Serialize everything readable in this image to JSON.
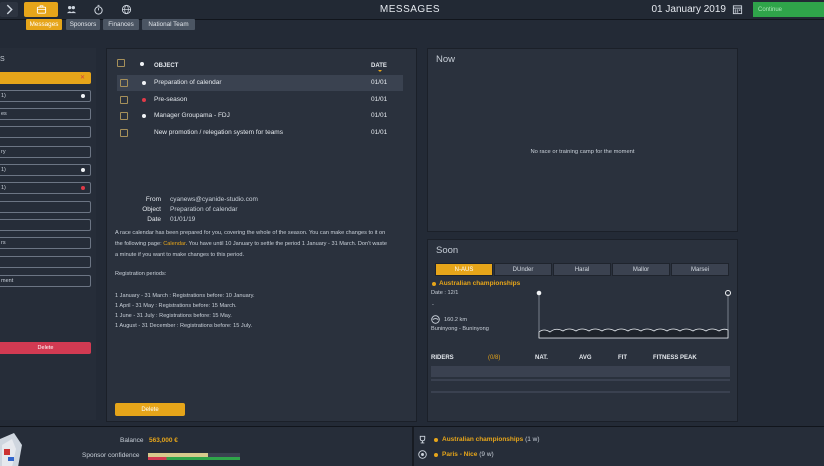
{
  "header": {
    "title": "MESSAGES",
    "date": "01 January 2019",
    "continue_label": "Continue",
    "tabs": [
      {
        "label": "Messages",
        "active": true
      },
      {
        "label": "Sponsors",
        "active": false
      },
      {
        "label": "Finances",
        "active": false
      },
      {
        "label": "National Team",
        "active": false
      }
    ],
    "icons": [
      "arrow-right-icon",
      "briefcase-icon",
      "group-icon",
      "stopwatch-icon",
      "globe-icon",
      "calendar-icon"
    ]
  },
  "left": {
    "heading": "S",
    "rows": [
      {
        "label": "",
        "marker": "x"
      },
      {
        "label": "1)",
        "marker": "dot-white"
      },
      {
        "label": "es",
        "marker": ""
      },
      {
        "label": "",
        "marker": ""
      },
      {
        "label": "ry",
        "marker": ""
      },
      {
        "label": "1)",
        "marker": "dot-white"
      },
      {
        "label": "1)",
        "marker": "dot-red"
      },
      {
        "label": "",
        "marker": ""
      },
      {
        "label": "",
        "marker": ""
      },
      {
        "label": "rs",
        "marker": ""
      },
      {
        "label": "",
        "marker": ""
      },
      {
        "label": "ment",
        "marker": ""
      }
    ],
    "delete_label": "Delete"
  },
  "messages": {
    "col_object": "OBJECT",
    "col_date": "DATE",
    "rows": [
      {
        "subject": "Preparation of calendar",
        "date": "01/01",
        "marker": "dot-white",
        "selected": true
      },
      {
        "subject": "Pre-season",
        "date": "01/01",
        "marker": "dot-red",
        "selected": false
      },
      {
        "subject": "Manager Groupama - FDJ",
        "date": "01/01",
        "marker": "dot-white",
        "selected": false
      },
      {
        "subject": "New promotion / relegation system for teams",
        "date": "01/01",
        "marker": "",
        "selected": false
      }
    ],
    "detail": {
      "from_label": "From",
      "from": "cyanews@cyanide-studio.com",
      "object_label": "Object",
      "object": "Preparation of calendar",
      "date_label": "Date",
      "date": "01/01/19",
      "body_l1": "A race calendar has been prepared for you, covering the whole of the season. You can make changes to it on",
      "body_l2_pre": "the following page: ",
      "body_l2_link": "Calendar",
      "body_l2_post": ". You have until 10 January to settle the period 1 January - 31 March. Don't waste",
      "body_l3": "a minute if you want to make changes to this period.",
      "periods_title": "Registration periods:",
      "periods": [
        "1 January - 31 March : Registrations before: 10 January.",
        "1 April - 31 May : Registrations before: 15 March.",
        "1 June - 31 July : Registrations before: 15 May.",
        "1 August - 31 December : Registrations before: 15 July."
      ]
    },
    "delete_label": "Delete"
  },
  "now": {
    "title": "Now",
    "empty_text": "No race or training camp for the moment"
  },
  "soon": {
    "title": "Soon",
    "race_tabs": [
      {
        "label": "N-AUS",
        "active": true
      },
      {
        "label": "DUnder",
        "active": false
      },
      {
        "label": "Haral",
        "active": false
      },
      {
        "label": "Mallor",
        "active": false
      },
      {
        "label": "Marsei",
        "active": false
      }
    ],
    "race_name": "Australian championships",
    "race_date": "Date : 12/1",
    "race_dash": "-",
    "distance": "160.2 km",
    "route": "Buninyong - Buninyong",
    "riders_label": "RIDERS",
    "riders_count": "(0/8)",
    "col_nat": "NAT.",
    "col_avg": "AVG",
    "col_fit": "FIT",
    "col_peak": "FITNESS PEAK"
  },
  "bottom": {
    "balance_label": "Balance",
    "balance_value": "563,000 €",
    "sponsor_label": "Sponsor confidence",
    "sponsor_level": 0.65,
    "events": [
      {
        "name": "Australian championships",
        "detail": "(1 w)",
        "icon": "trophy-icon"
      },
      {
        "name": "Paris - Nice",
        "detail": "(9 w)",
        "icon": "target-icon"
      }
    ]
  },
  "colors": {
    "accent": "#e6a51a",
    "danger": "#d23a52",
    "go": "#2fa44a",
    "panel": "#2a313d",
    "background": "#232a36"
  }
}
